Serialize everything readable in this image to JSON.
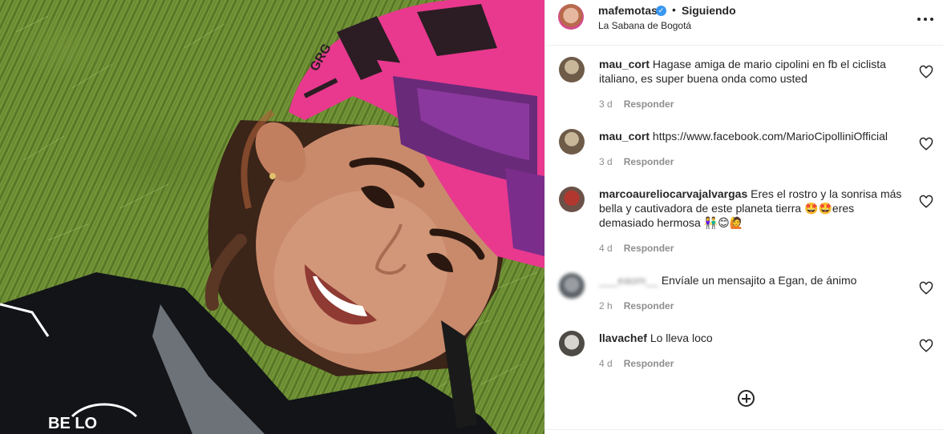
{
  "post": {
    "username": "mafemotas",
    "verified_icon": "verified-badge-icon",
    "separator": "•",
    "follow_status": "Siguiendo",
    "location": "La Sabana de Bogotá",
    "more_icon": "more-options-icon"
  },
  "photo": {
    "description_icon": "post-photo",
    "helmet_text": "GRG",
    "accent_color": "#e8398e"
  },
  "comments": [
    {
      "username": "mau_cort",
      "text": "Hagase amiga de mario cipolini en fb el ciclista italiano, es super buena onda como usted",
      "time": "3 d",
      "reply": "Responder"
    },
    {
      "username": "mau_cort",
      "text": "https://www.facebook.com/MarioCipolliniOfficial",
      "time": "3 d",
      "reply": "Responder"
    },
    {
      "username": "marcoaureliocarvajalvargas",
      "text": "Eres el rostro y la sonrisa más bella y cautivadora de este planeta tierra 🤩🤩eres demasiado hermosa 👫😊🙋",
      "time": "4 d",
      "reply": "Responder"
    },
    {
      "username": "___eaom__",
      "text": "Envíale un mensajito a Egan, de ánimo",
      "time": "2 h",
      "reply": "Responder"
    },
    {
      "username": "llavachef",
      "text": "Lo lleva loco",
      "time": "4 d",
      "reply": "Responder"
    }
  ],
  "load_more_icon": "add-circle-icon",
  "colors": {
    "text": "#262626",
    "muted": "#8e8e8e",
    "verified": "#3897f0",
    "divider": "#efefef"
  }
}
